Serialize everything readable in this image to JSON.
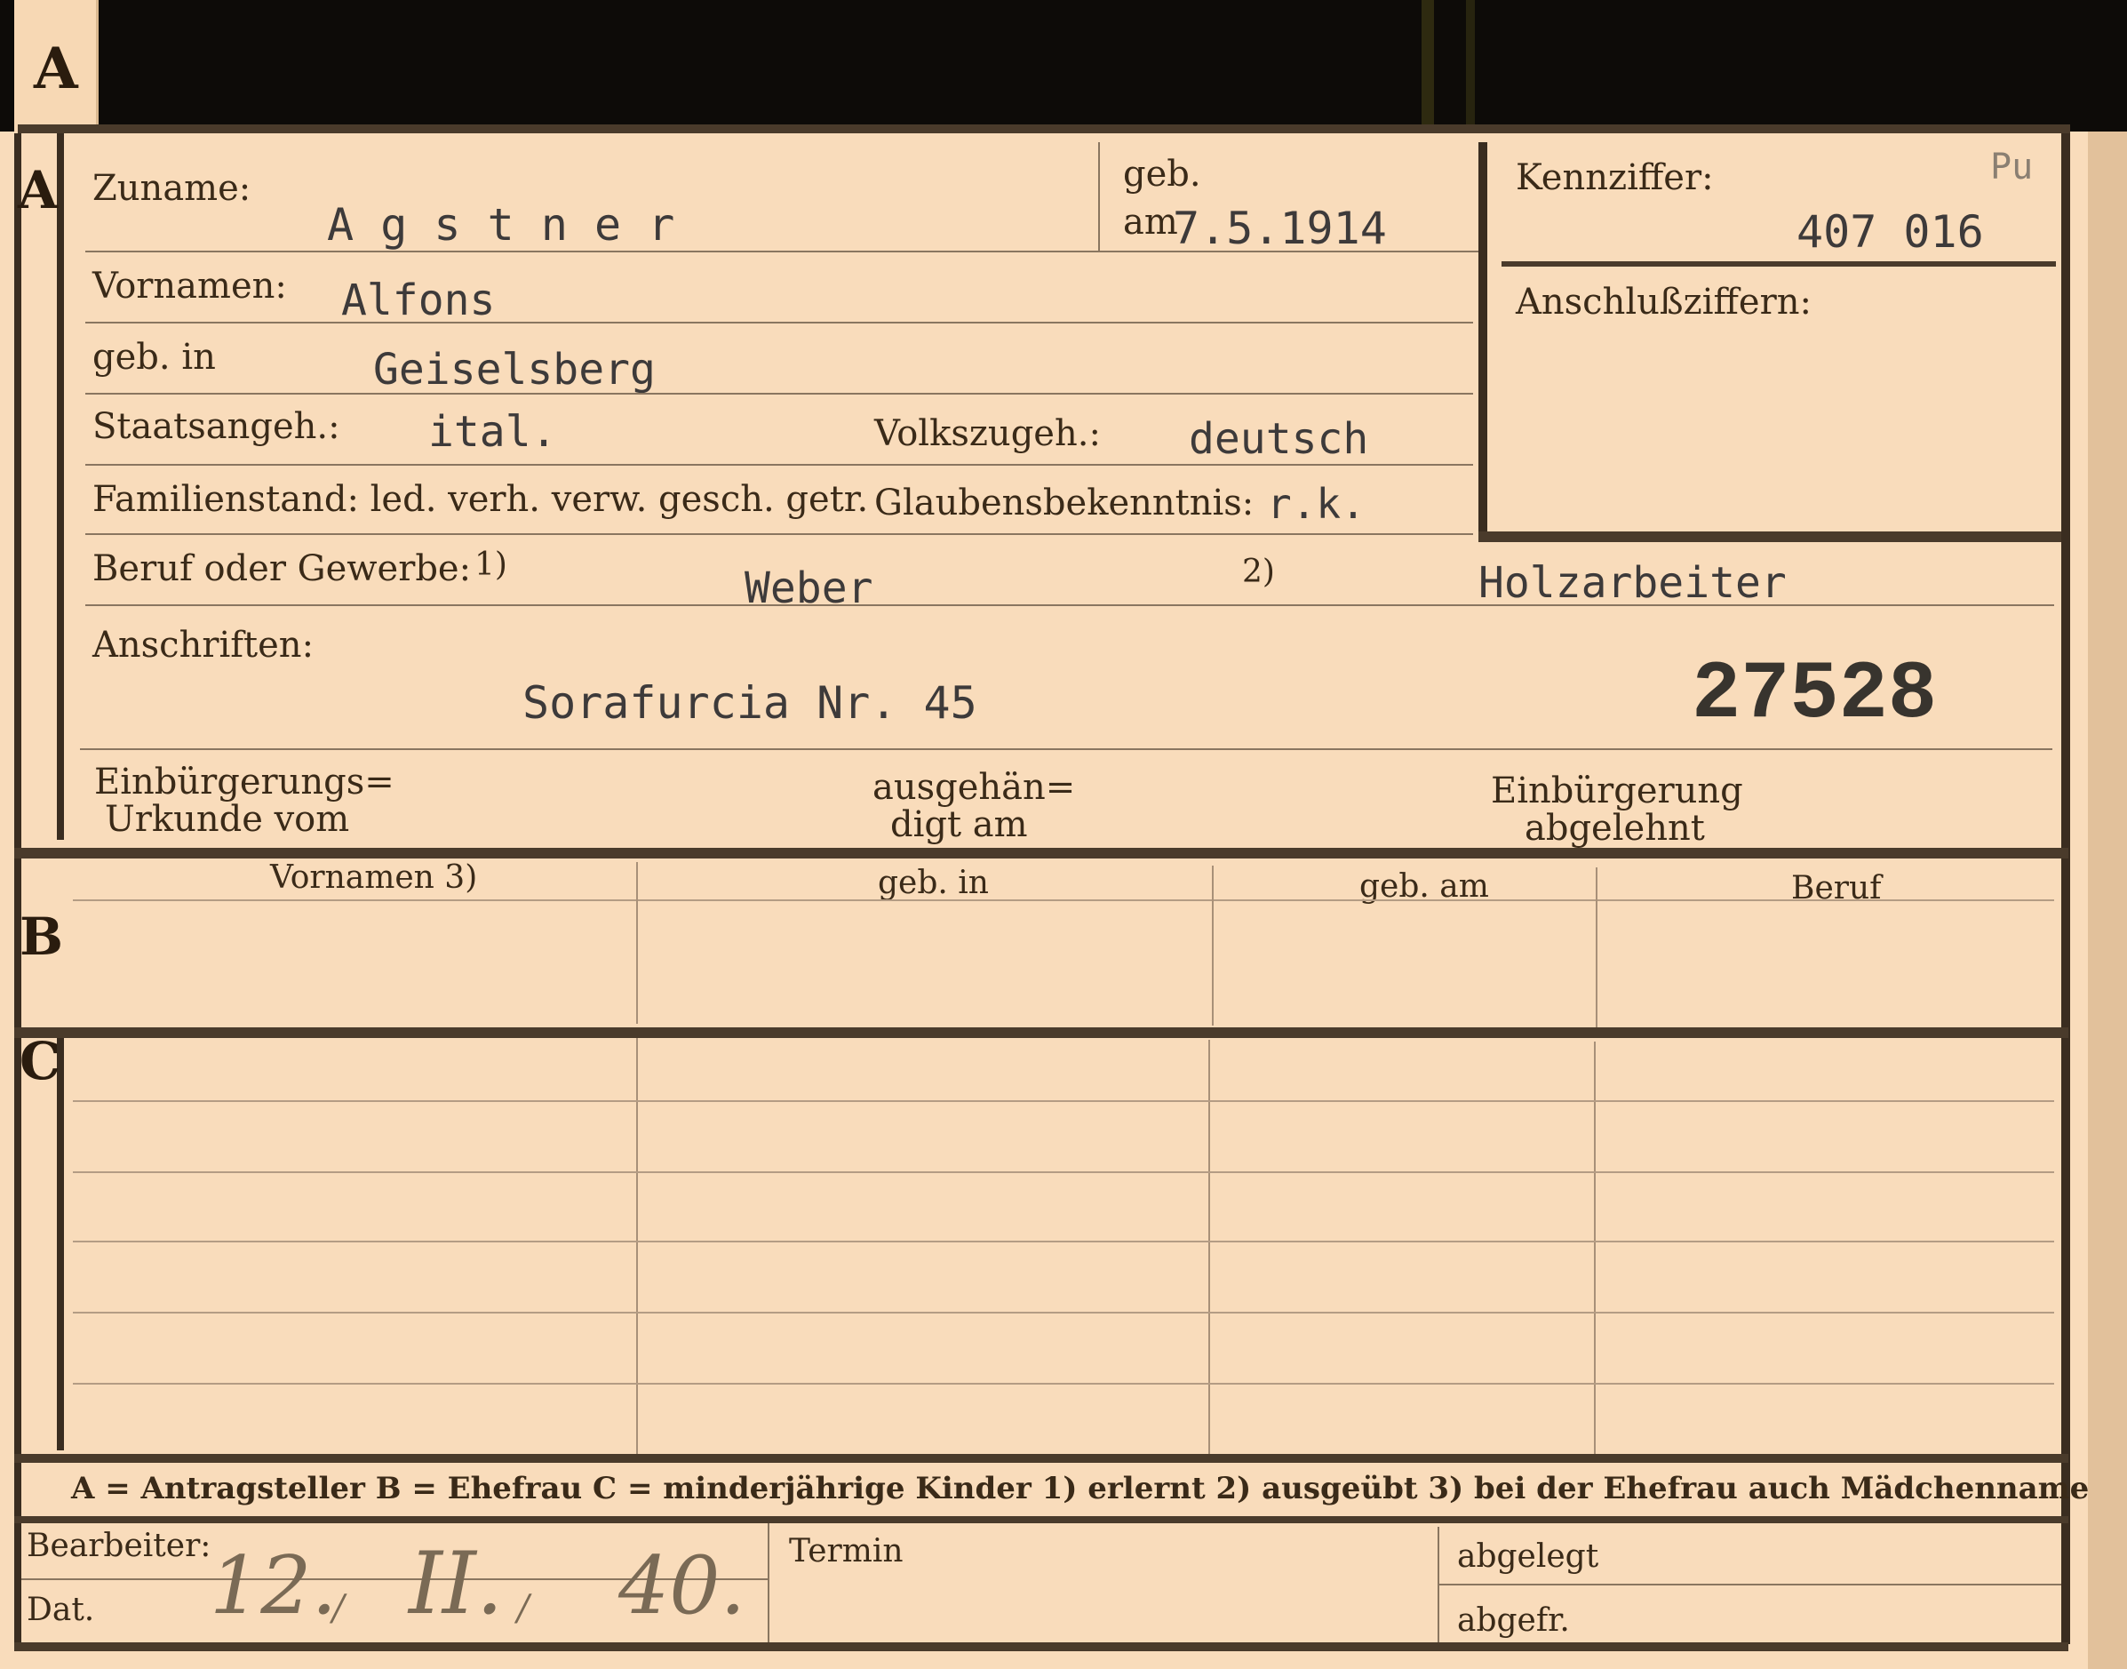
{
  "sections": {
    "a": "A",
    "b": "B",
    "c": "C"
  },
  "labels": {
    "zuname": "Zuname:",
    "geb": "geb.",
    "am": "am",
    "kennziffer": "Kennziffer:",
    "vornamen": "Vornamen:",
    "anschlussziffern": "Anschlußziffern:",
    "geb_in": "geb. in",
    "staatsangeh": "Staatsangeh.:",
    "volkszugeh": "Volkszugeh.:",
    "familienstand": "Familienstand: led. verh. verw. gesch. getr.",
    "glaubensbekenntnis": "Glaubensbekenntnis:",
    "beruf": "Beruf oder Gewerbe:",
    "fn1": "1)",
    "fn2": "2)",
    "anschriften": "Anschriften:",
    "einbuerg_1": "Einbürgerungs=",
    "einbuerg_2": "Urkunde vom",
    "ausgeh_1": "ausgehän=",
    "ausgeh_2": "digt am",
    "abgelehnt_1": "Einbürgerung",
    "abgelehnt_2": "abgelehnt",
    "bearbeiter": "Bearbeiter:",
    "dat": "Dat.",
    "termin": "Termin",
    "abgelegt": "abgelegt",
    "abgefr": "abgefr."
  },
  "values": {
    "zuname": "A g s t n e r",
    "geb_am": "7.5.1914",
    "kennziffer_prefix": "Pu",
    "kennziffer": "407 016",
    "vornamen": "Alfons",
    "geb_in": "Geiselsberg",
    "staatsangeh": "ital.",
    "volkszugeh": "deutsch",
    "glaubensbekenntnis": "r.k.",
    "beruf_erlernt": "Weber",
    "beruf_ausgeuebt": "Holzarbeiter",
    "anschrift": "Sorafurcia Nr. 45",
    "stamp_number": "27528",
    "dat_day": "12.",
    "dat_month": "II.",
    "dat_year": "40.",
    "sep1": "/",
    "sep2": "/"
  },
  "table_headers": [
    "Vornamen 3)",
    "geb. in",
    "geb. am",
    "Beruf"
  ],
  "legend": "A = Antragsteller   B = Ehefrau   C = minderjährige Kinder   1) erlernt   2) ausgeübt   3) bei der Ehefrau auch Mädchenname"
}
